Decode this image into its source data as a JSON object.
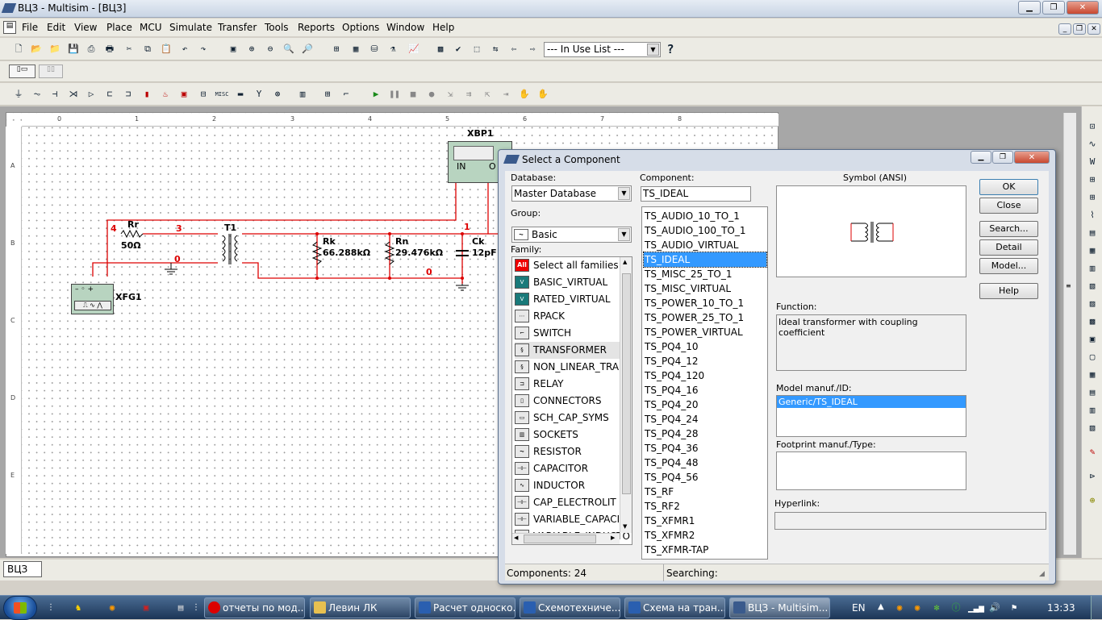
{
  "window": {
    "title": "ВЦЗ - Multisim - [ВЦЗ]",
    "min": "▁",
    "restore": "❐",
    "close": "✕"
  },
  "menu": [
    "File",
    "Edit",
    "View",
    "Place",
    "MCU",
    "Simulate",
    "Transfer",
    "Tools",
    "Reports",
    "Options",
    "Window",
    "Help"
  ],
  "toolbar": {
    "in_use_list": "--- In Use List ---"
  },
  "schematic": {
    "xbp": "XBP1",
    "xbp_in": "IN",
    "xbp_out": "O",
    "rr": "Rr",
    "rr_val": "50Ω",
    "t1": "T1",
    "rk": "Rk",
    "rk_val": "66.288kΩ",
    "rn": "Rn",
    "rn_val": "29.476kΩ",
    "ck": "Ck",
    "ck_val": "12pF",
    "xfg": "XFG1",
    "nodes": {
      "n4": "4",
      "n3": "3",
      "n0a": "0",
      "n1": "1",
      "n0b": "0"
    }
  },
  "ruler": {
    "cols": [
      "0",
      "1",
      "2",
      "3",
      "4",
      "5",
      "6",
      "7",
      "8"
    ],
    "rows": [
      "A",
      "B",
      "C",
      "D",
      "E"
    ]
  },
  "sheet_tab": "ВЦЗ",
  "dialog": {
    "title": "Select a Component",
    "database_label": "Database:",
    "database": "Master Database",
    "group_label": "Group:",
    "group": "Basic",
    "family_label": "Family:",
    "families": [
      "Select all families",
      "BASIC_VIRTUAL",
      "RATED_VIRTUAL",
      "RPACK",
      "SWITCH",
      "TRANSFORMER",
      "NON_LINEAR_TRANS",
      "RELAY",
      "CONNECTORS",
      "SCH_CAP_SYMS",
      "SOCKETS",
      "RESISTOR",
      "CAPACITOR",
      "INDUCTOR",
      "CAP_ELECTROLIT",
      "VARIABLE_CAPACITO",
      "VARIABLE_INDUCTO"
    ],
    "component_label": "Component:",
    "component": "TS_IDEAL",
    "components": [
      "TS_AUDIO_10_TO_1",
      "TS_AUDIO_100_TO_1",
      "TS_AUDIO_VIRTUAL",
      "TS_IDEAL",
      "TS_MISC_25_TO_1",
      "TS_MISC_VIRTUAL",
      "TS_POWER_10_TO_1",
      "TS_POWER_25_TO_1",
      "TS_POWER_VIRTUAL",
      "TS_PQ4_10",
      "TS_PQ4_12",
      "TS_PQ4_120",
      "TS_PQ4_16",
      "TS_PQ4_20",
      "TS_PQ4_24",
      "TS_PQ4_28",
      "TS_PQ4_36",
      "TS_PQ4_48",
      "TS_PQ4_56",
      "TS_RF",
      "TS_RF2",
      "TS_XFMR1",
      "TS_XFMR2",
      "TS_XFMR-TAP"
    ],
    "selected_component_index": 3,
    "symbol_label": "Symbol (ANSI)",
    "function_label": "Function:",
    "function": "Ideal transformer with coupling coefficient",
    "model_label": "Model manuf./ID:",
    "model": "Generic/TS_IDEAL",
    "footprint_label": "Footprint manuf./Type:",
    "hyperlink_label": "Hyperlink:",
    "buttons": {
      "ok": "OK",
      "close": "Close",
      "search": "Search...",
      "detail": "Detail Report",
      "model": "Model...",
      "help": "Help"
    },
    "status_components": "Components: 24",
    "status_searching": "Searching:"
  },
  "taskbar": {
    "items": [
      "отчеты по мод...",
      "Левин ЛК",
      "Расчет односко...",
      "Схемотехниче...",
      "Схема на тран...",
      "ВЦЗ - Multisim..."
    ],
    "lang": "EN",
    "time": "13:33"
  },
  "colors": {
    "wire": "#dd0000",
    "selection": "#3399ff",
    "taskbar": "#1c3556"
  }
}
